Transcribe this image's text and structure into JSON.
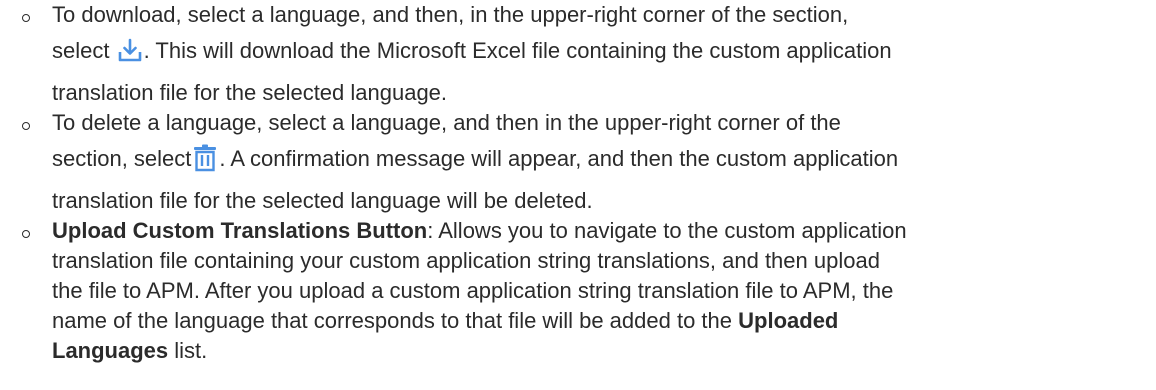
{
  "items": [
    {
      "lines": [
        "To download, select a language, and then, in the upper-right corner of the section,",
        "select",
        ". This will download the Microsoft Excel file containing the custom application",
        "translation file for the selected language."
      ],
      "icon": "download-icon"
    },
    {
      "lines": [
        "To delete a language, select a language, and then in the upper-right corner of the",
        "section, select",
        ". A confirmation message will appear, and then the custom application",
        "translation file for the selected language will be deleted."
      ],
      "icon": "trash-icon"
    },
    {
      "term": "Upload Custom Translations Button",
      "lines": [
        ": Allows you to navigate to the custom application",
        "translation file containing your custom application string translations, and then upload",
        "the file to APM. After you upload a custom application string translation file to APM, the",
        "name of the language that corresponds to that file will be added to the",
        "Uploaded",
        "Languages",
        " list."
      ]
    }
  ],
  "colors": {
    "text": "#2b2b2b",
    "icon_accent": "#4a90e2"
  }
}
